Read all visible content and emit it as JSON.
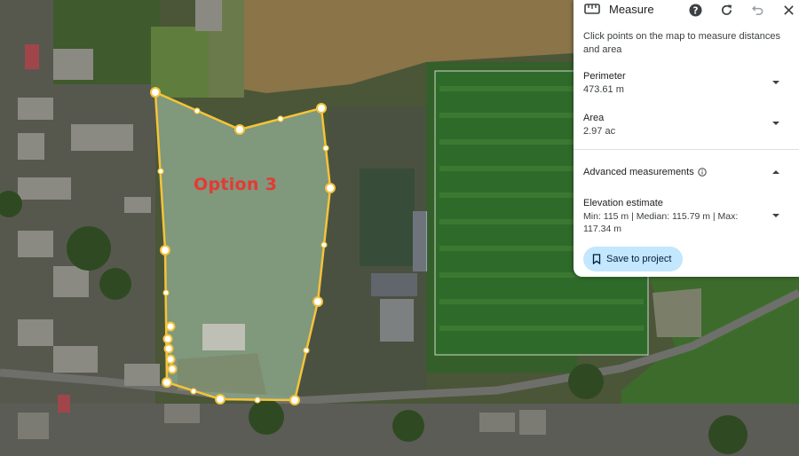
{
  "map": {
    "overlay_label": "Option 3",
    "polygon_color": "#f5c33b",
    "label_color": "#e53935"
  },
  "panel": {
    "title": "Measure",
    "icons": [
      "ruler-icon",
      "help-icon",
      "refresh-icon",
      "undo-icon",
      "close-icon"
    ],
    "description": "Click points on the map to measure distances and area",
    "perimeter": {
      "label": "Perimeter",
      "value": "473.61 m"
    },
    "area": {
      "label": "Area",
      "value": "2.97 ac"
    },
    "advanced": {
      "label": "Advanced measurements",
      "info_icon": "info-icon"
    },
    "elevation": {
      "label": "Elevation estimate",
      "value": "Min: 115 m | Median: 115.79 m | Max: 117.34 m"
    },
    "save_button": {
      "label": "Save to project",
      "icon": "bookmark-icon",
      "color": "#c2e7ff"
    }
  }
}
